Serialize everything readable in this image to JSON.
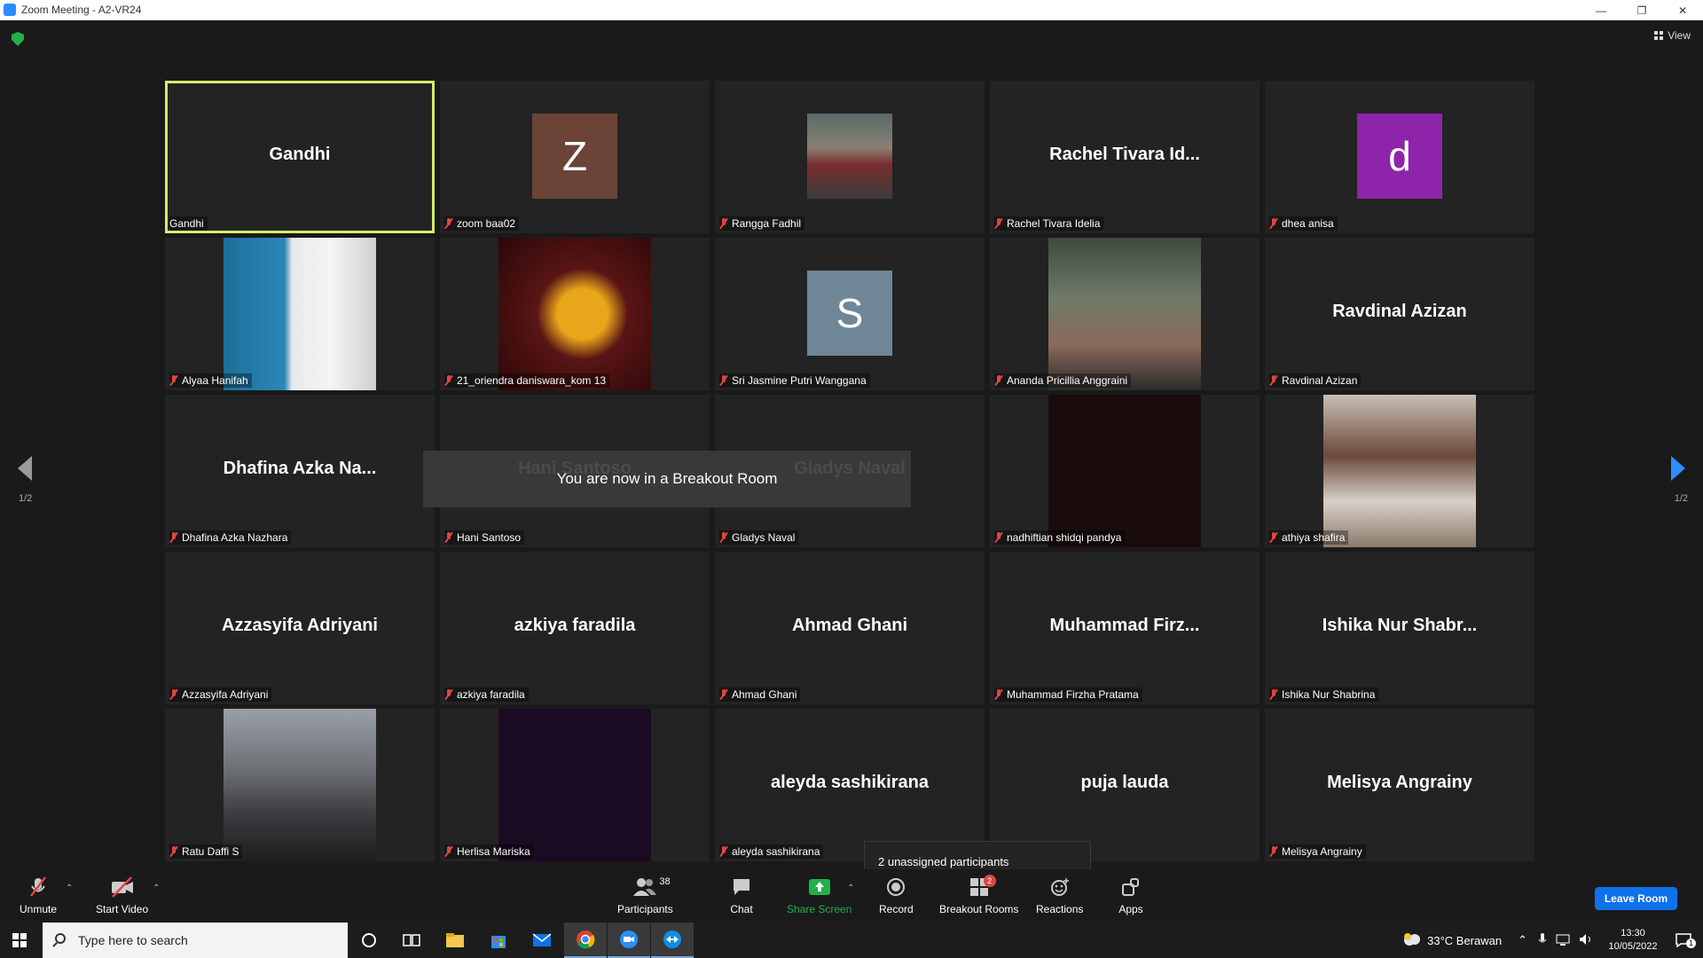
{
  "window": {
    "title": "Zoom Meeting - A2-VR24",
    "controls": [
      "—",
      "❐",
      "✕"
    ]
  },
  "header": {
    "view_label": "View"
  },
  "pagination": {
    "left": "1/2",
    "right": "1/2"
  },
  "tiles": [
    {
      "name": "Gandhi",
      "display": "Gandhi",
      "kind": "text",
      "active": true,
      "muted": false
    },
    {
      "name": "zoom baa02",
      "display": "Z",
      "kind": "avatar",
      "color": "#6b4437",
      "muted": true
    },
    {
      "name": "Rangga Fadhil",
      "display": "",
      "kind": "photo-sm",
      "muted": true
    },
    {
      "name": "Rachel Tivara Idelia",
      "display": "Rachel Tivara Id...",
      "kind": "text",
      "muted": true
    },
    {
      "name": "dhea anisa",
      "display": "d",
      "kind": "avatar",
      "color": "#8e24aa",
      "muted": true
    },
    {
      "name": "Alyaa Hanifah",
      "display": "",
      "kind": "photo",
      "muted": true
    },
    {
      "name": "21_oriendra daniswara_kom 13",
      "display": "",
      "kind": "photo",
      "muted": true
    },
    {
      "name": "Sri Jasmine Putri Wanggana",
      "display": "S",
      "kind": "avatar",
      "color": "#6f8797",
      "muted": true
    },
    {
      "name": "Ananda Pricillia Anggraini",
      "display": "",
      "kind": "photo",
      "muted": true
    },
    {
      "name": "Ravdinal Azizan",
      "display": "Ravdinal Azizan",
      "kind": "text",
      "muted": true
    },
    {
      "name": "Dhafina Azka Nazhara",
      "display": "Dhafina Azka Na...",
      "kind": "text",
      "muted": true
    },
    {
      "name": "Hani Santoso",
      "display": "Hani Santoso",
      "kind": "text",
      "muted": true
    },
    {
      "name": "Gladys Naval",
      "display": "Gladys Naval",
      "kind": "text",
      "muted": true
    },
    {
      "name": "nadhiftian shidqi pandya",
      "display": "",
      "kind": "photo",
      "muted": true
    },
    {
      "name": "athiya shafira",
      "display": "",
      "kind": "photo",
      "muted": true
    },
    {
      "name": "Azzasyifa Adriyani",
      "display": "Azzasyifa Adriyani",
      "kind": "text",
      "muted": true
    },
    {
      "name": "azkiya faradila",
      "display": "azkiya faradila",
      "kind": "text",
      "muted": true
    },
    {
      "name": "Ahmad Ghani",
      "display": "Ahmad Ghani",
      "kind": "text",
      "muted": true
    },
    {
      "name": "Muhammad Firzha Pratama",
      "display": "Muhammad Firz...",
      "kind": "text",
      "muted": true
    },
    {
      "name": "Ishika Nur Shabrina",
      "display": "Ishika Nur Shabr...",
      "kind": "text",
      "muted": true
    },
    {
      "name": "Ratu Daffi S",
      "display": "",
      "kind": "photo",
      "muted": true
    },
    {
      "name": "Herlisa Mariska",
      "display": "",
      "kind": "photo",
      "muted": true
    },
    {
      "name": "aleyda sashikirana",
      "display": "aleyda sashikirana",
      "kind": "text",
      "muted": true
    },
    {
      "name": "puja lauda",
      "display": "puja lauda",
      "kind": "text",
      "muted": false
    },
    {
      "name": "Melisya Angrainy",
      "display": "Melisya Angrainy",
      "kind": "text",
      "muted": true
    }
  ],
  "toast": {
    "message": "You are now in a Breakout Room"
  },
  "tooltip": {
    "unassigned": "2 unassigned participants"
  },
  "toolbar": {
    "unmute": "Unmute",
    "start_video": "Start Video",
    "participants": "Participants",
    "participants_count": "38",
    "chat": "Chat",
    "share_screen": "Share Screen",
    "record": "Record",
    "breakout_rooms": "Breakout Rooms",
    "breakout_badge": "2",
    "reactions": "Reactions",
    "apps": "Apps",
    "leave_room": "Leave Room"
  },
  "taskbar": {
    "search_placeholder": "Type here to search",
    "weather": "33°C  Berawan",
    "time": "13:30",
    "date": "10/05/2022",
    "notification_count": "1"
  },
  "colors": {
    "accent": "#2d8cff",
    "active_speaker": "#d4ef6a",
    "share_green": "#21b04b",
    "muted_red": "#e0453f"
  }
}
